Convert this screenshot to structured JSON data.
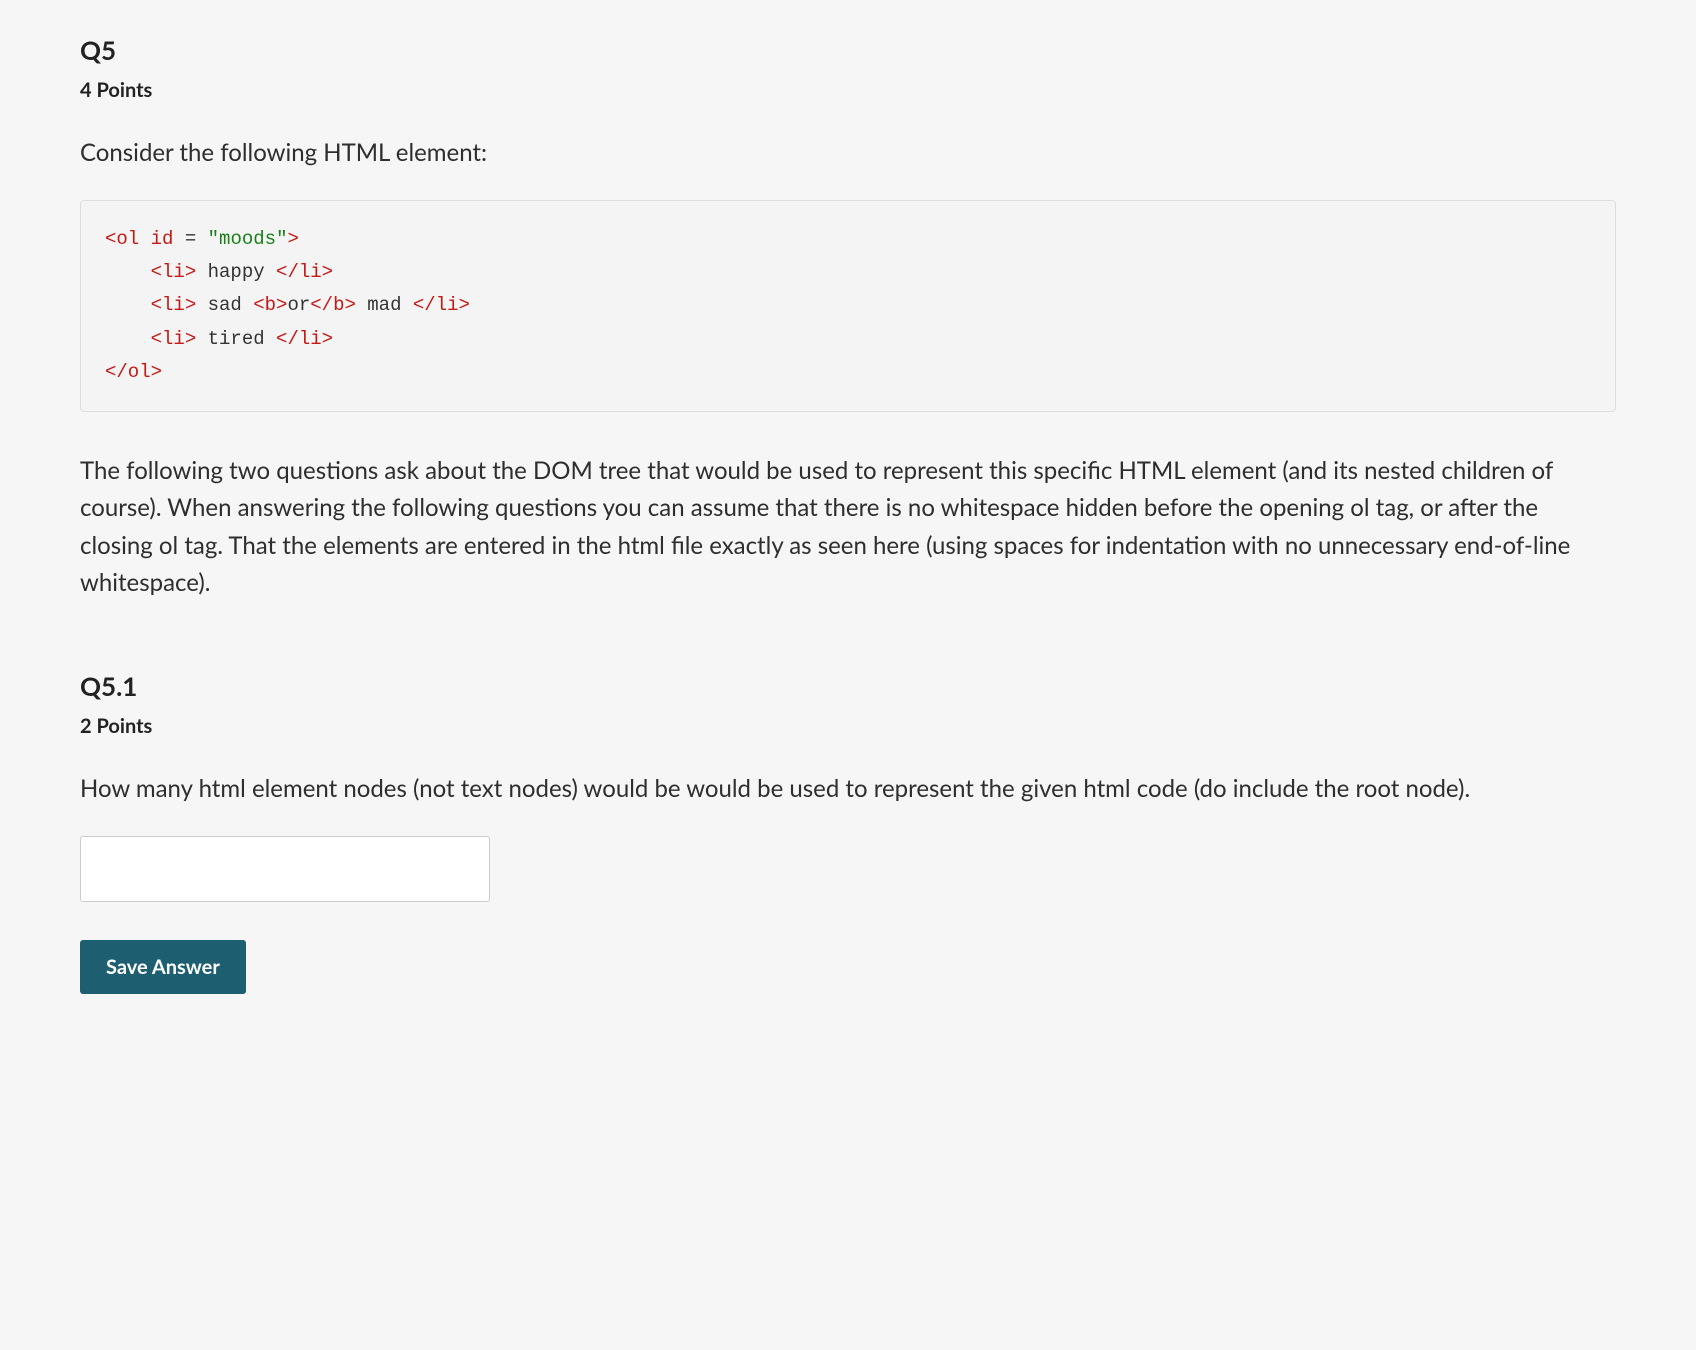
{
  "question": {
    "number": "Q5",
    "points": "4 Points",
    "prompt": "Consider the following HTML element:",
    "code": {
      "line1": {
        "tag_open": "<ol",
        "attr": " id",
        "eq": " = ",
        "str": "\"moods\"",
        "tag_close": ">"
      },
      "line2": {
        "indent": "    ",
        "open": "<li>",
        "text": " happy ",
        "close": "</li>"
      },
      "line3": {
        "indent": "    ",
        "open": "<li>",
        "text1": " sad ",
        "bopen": "<b>",
        "btext": "or",
        "bclose": "</b>",
        "text2": " mad ",
        "close": "</li>"
      },
      "line4": {
        "indent": "    ",
        "open": "<li>",
        "text": " tired ",
        "close": "</li>"
      },
      "line5": {
        "close": "</ol>"
      }
    },
    "body": "The following two questions ask about the DOM tree that would be used to represent this specific HTML element (and its nested children of course). When answering the following questions you can assume that there is no whitespace hidden before the opening ol tag, or after the closing ol tag. That the elements are entered in the html file exactly as seen here (using spaces for indentation with no unnecessary end-of-line whitespace)."
  },
  "subquestion": {
    "number": "Q5.1",
    "points": "2 Points",
    "prompt": "How many html element nodes (not text nodes) would be would be used to represent the given html code (do include the root node).",
    "answer_value": "",
    "save_label": "Save Answer"
  }
}
